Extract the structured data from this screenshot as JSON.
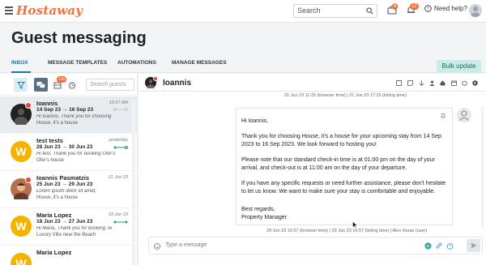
{
  "app": {
    "logo": "Hostaway"
  },
  "topbar": {
    "search_placeholder": "Search",
    "notifications_count": "6",
    "alerts_count": "12",
    "help_label": "Need help?"
  },
  "page": {
    "title": "Guest messaging"
  },
  "tabs": [
    {
      "label": "INBOX",
      "active": true
    },
    {
      "label": "MESSAGE TEMPLATES",
      "active": false
    },
    {
      "label": "AUTOMATIONS",
      "active": false
    },
    {
      "label": "MANAGE MESSAGES",
      "active": false
    }
  ],
  "bulk_update_label": "Bulk update",
  "filters": {
    "inbox_badge": "100",
    "search_placeholder": "Search guests"
  },
  "conversations": [
    {
      "initial": "",
      "name": "Ioannis",
      "time": "10:57 AM",
      "dates": "14 Sep 23 → 16 Sep 23",
      "message": "Hi Ioannis, Thank you for choosing",
      "property": "House, it's a house",
      "avatar_color": "#222222",
      "selected": true
    },
    {
      "initial": "W",
      "name": "test tests",
      "time": "yesterday",
      "dates": "28 Jun 23 → 30 Jun 23",
      "message": "Hi test, Thank you for booking Ofer's",
      "property": "Ofer's house",
      "avatar_color": "#f5b301",
      "selected": false
    },
    {
      "initial": "",
      "name": "Ioannis Pasmatzis",
      "time": "21 Jun 23",
      "dates": "25 Jun 23 → 29 Jun 23",
      "message": "Lorem ipsum dolor sit amet,",
      "property": "House, it's a house",
      "avatar_color": "#b5704e",
      "selected": false
    },
    {
      "initial": "W",
      "name": "Maria Lopez",
      "time": "19 Jun 23",
      "dates": "18 Jun 23 → 27 Jun 23",
      "message": "Hi Maria, Thank you for booking Te",
      "property": "Luxury Villa near the Beach",
      "avatar_color": "#f5b301",
      "selected": false
    },
    {
      "initial": "W",
      "name": "Maria Lopez",
      "time": "",
      "dates": "",
      "message": "",
      "property": "",
      "avatar_color": "#f5b301",
      "selected": false
    }
  ],
  "chat": {
    "guest_name": "Ioannis",
    "meta_top": "21 Jun 23 11:25  (browser time)   |   21 Jun 23 17:25  (listing time)",
    "message_lines": [
      "Hi Ioannis,",
      "Thank you for choosing House, it's a house for your upcoming stay from 14 Sep 2023 to 16 Sep 2023. We look forward to hosting you!",
      "Please note that our standard check-in time is at 01:00 pm on the day of your arrival, and check-out is at 11:00 am on the day of your departure.",
      "If you have any specific requests or need further assistance, please don't hesitate to let us know. We want to make sure your stay is comfortable and enjoyable.",
      "Best regards,",
      "Property Manager"
    ],
    "meta_bottom": "29 Jun 23 10:57  (browser time)   |   29 Jun 23 16:57  (listing time)   |   Alex Huras (user)",
    "composer_placeholder": "Type a message"
  },
  "colors": {
    "brand": "#f36f3c",
    "accent": "#1a78a8",
    "online": "#21a35a"
  }
}
